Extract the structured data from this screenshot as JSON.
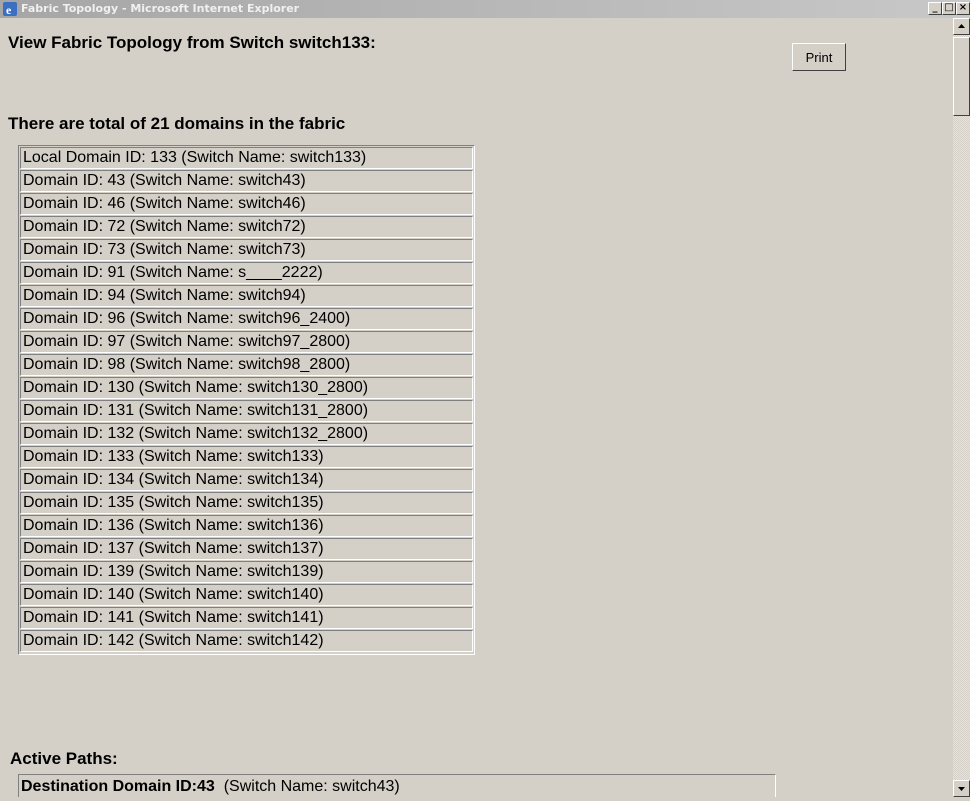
{
  "window": {
    "title": "Fabric Topology - Microsoft Internet Explorer",
    "min_label": "_",
    "max_label": "□",
    "close_label": "×",
    "app_icon": "ie-icon"
  },
  "page": {
    "heading": "View Fabric Topology from Switch switch133:",
    "print_label": "Print",
    "subheading": "There are total of 21 domains in the fabric",
    "domains": [
      "Local Domain ID: 133  (Switch Name:  switch133)",
      "Domain ID:  43  (Switch Name:  switch43)",
      "Domain ID:  46  (Switch Name:  switch46)",
      "Domain ID:  72  (Switch Name:  switch72)",
      "Domain ID:  73  (Switch Name:  switch73)",
      "Domain ID:  91  (Switch Name:  s____2222)",
      "Domain ID:  94  (Switch Name:  switch94)",
      "Domain ID:  96  (Switch Name:  switch96_2400)",
      "Domain ID:  97  (Switch Name:  switch97_2800)",
      "Domain ID:  98  (Switch Name:  switch98_2800)",
      "Domain ID:  130  (Switch Name:  switch130_2800)",
      "Domain ID:  131  (Switch Name:  switch131_2800)",
      "Domain ID:  132  (Switch Name:  switch132_2800)",
      "Domain ID:  133  (Switch Name:  switch133)",
      "Domain ID:  134  (Switch Name:  switch134)",
      "Domain ID:  135  (Switch Name:  switch135)",
      "Domain ID:  136  (Switch Name:  switch136)",
      "Domain ID:  137  (Switch Name:  switch137)",
      "Domain ID:  139  (Switch Name:  switch139)",
      "Domain ID:  140  (Switch Name:  switch140)",
      "Domain ID:  141  (Switch Name:  switch141)",
      "Domain ID:  142  (Switch Name:  switch142)"
    ],
    "active_paths_label": "Active Paths:",
    "destination": {
      "label": "Destination Domain ID:43",
      "switch_text": "  (Switch Name: switch43)"
    }
  },
  "scrollbar": {
    "up_icon": "arrow-up-icon",
    "down_icon": "arrow-down-icon"
  }
}
